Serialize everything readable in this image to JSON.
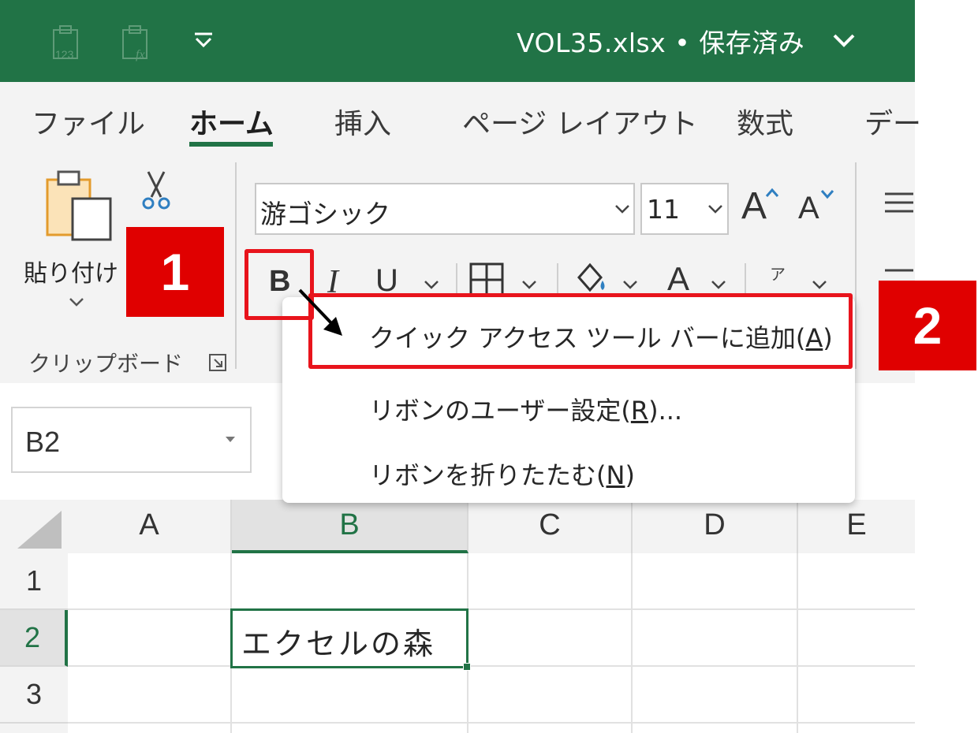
{
  "titlebar": {
    "document_title": "VOL35.xlsx • 保存済み",
    "qat_icons": [
      "paste-values-icon",
      "paste-formulas-icon"
    ],
    "accent_color": "#217346"
  },
  "ribbon": {
    "tabs": [
      {
        "label": "ファイル",
        "active": false
      },
      {
        "label": "ホーム",
        "active": true
      },
      {
        "label": "挿入",
        "active": false
      },
      {
        "label": "ページ レイアウト",
        "active": false
      },
      {
        "label": "数式",
        "active": false
      },
      {
        "label": "デー",
        "active": false
      }
    ],
    "clipboard": {
      "paste_label": "貼り付け",
      "group_label": "クリップボード"
    },
    "font": {
      "font_name": "游ゴシック",
      "font_size": "11",
      "grow_label": "A",
      "shrink_label": "A",
      "bold_label": "B",
      "italic_label": "I",
      "underline_label": "U",
      "font_color_label": "A",
      "phonetic_label": "ア"
    }
  },
  "context_menu": {
    "items": [
      {
        "label": "クイック アクセス ツール バーに追加(",
        "key": "A",
        "suffix": ")"
      },
      {
        "label": "リボンのユーザー設定(",
        "key": "R",
        "suffix": ")..."
      },
      {
        "label": "リボンを折りたたむ(",
        "key": "N",
        "suffix": ")"
      }
    ]
  },
  "namebox": {
    "value": "B2"
  },
  "grid": {
    "columns": [
      "A",
      "B",
      "C",
      "D",
      "E"
    ],
    "rows": [
      "1",
      "2",
      "3"
    ],
    "selected_column": "B",
    "selected_row": "2",
    "cells": {
      "B2": "エクセルの森"
    }
  },
  "annotations": {
    "step1": "1",
    "step2": "2",
    "highlight_color": "#e8141c"
  }
}
